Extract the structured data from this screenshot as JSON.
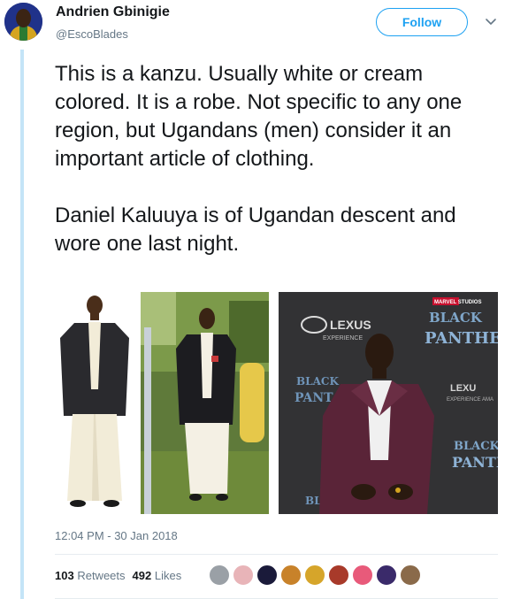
{
  "tweet": {
    "author_name": "Andrien Gbinigie",
    "handle": "@EscoBlades",
    "follow_label": "Follow",
    "text": "This is a kanzu. Usually white or cream colored. It is a robe. Not specific to any one region, but Ugandans (men) consider it an important article of clothing.\n\nDaniel Kaluuya is of Ugandan descent and wore one last night.",
    "timestamp": "12:04 PM - 30 Jan 2018",
    "retweets_count": "103",
    "retweets_label": "Retweets",
    "likes_count": "492",
    "likes_label": "Likes"
  },
  "media": {
    "photo3_sign": {
      "lexus": "LEXUS",
      "experience": "EXPERIENCE",
      "black": "BLACK",
      "panther": "PANTHER",
      "marvel": "MARVEL STUDIOS"
    }
  },
  "colors": {
    "accent": "#1da1f2",
    "thread_line": "#c4e4f7",
    "secondary_text": "#657786"
  },
  "likers": [
    {
      "color": "#9aa0a6"
    },
    {
      "color": "#e8b4b8"
    },
    {
      "color": "#1a1a3a"
    },
    {
      "color": "#c8822a"
    },
    {
      "color": "#d6a52a"
    },
    {
      "color": "#a83a2a"
    },
    {
      "color": "#e85a7a"
    },
    {
      "color": "#3a2a6a"
    },
    {
      "color": "#8a6a4a"
    }
  ]
}
